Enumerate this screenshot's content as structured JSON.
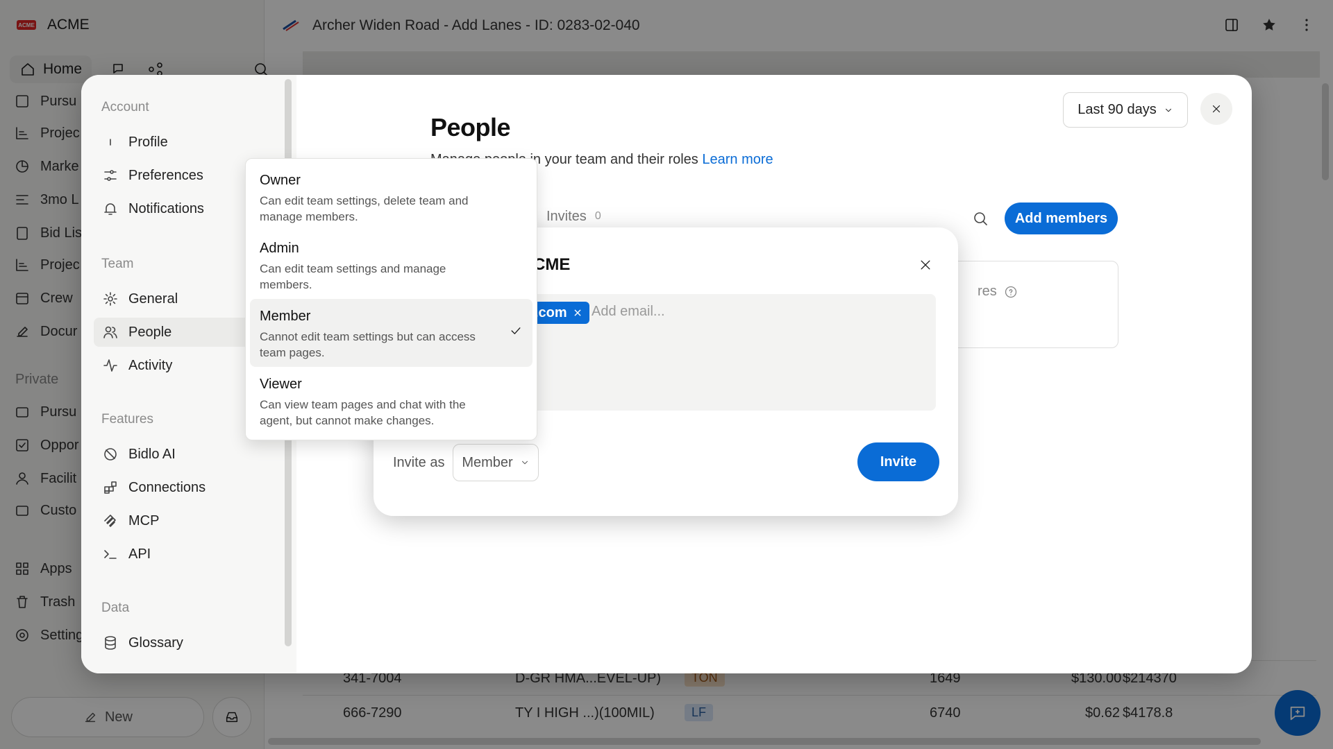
{
  "app": {
    "brand": "ACME",
    "brand_logo": "ACME",
    "home": "Home",
    "nav_items": [
      "Pursu",
      "Projec",
      "Marke",
      "3mo L",
      "Bid Lis",
      "Projec",
      "Crew",
      "Docur"
    ],
    "private_label": "Private",
    "private_items": [
      "Pursu",
      "Oppor",
      "Facilit",
      "Custo"
    ],
    "bottom_items": [
      "Apps",
      "Trash",
      "Setting"
    ],
    "new_label": "New"
  },
  "header": {
    "title": "Archer Widen Road - Add Lanes - ID: 0283-02-040"
  },
  "table": {
    "rows": [
      {
        "id": "341-7004",
        "desc": "D-GR HMA...EVEL-UP)",
        "unit": "TON",
        "qty": "1649",
        "price": "$130.00",
        "total": "$214370"
      },
      {
        "id": "666-7290",
        "desc": "TY I HIGH ...)(100MIL)",
        "unit": "LF",
        "qty": "6740",
        "price": "$0.62",
        "total": "$4178.8"
      }
    ]
  },
  "settings": {
    "groups": {
      "account": "Account",
      "team": "Team",
      "features": "Features",
      "data": "Data"
    },
    "items": {
      "profile": "Profile",
      "preferences": "Preferences",
      "notifications": "Notifications",
      "general": "General",
      "people": "People",
      "activity": "Activity",
      "bidlo_ai": "Bidlo AI",
      "connections": "Connections",
      "mcp": "MCP",
      "api": "API",
      "glossary": "Glossary"
    }
  },
  "people": {
    "title": "People",
    "subtitle": "Manage people in your team and their roles",
    "learn_more": "Learn more",
    "range": "Last 90 days",
    "tab_invites": "Invites",
    "invites_count": "0",
    "add_members": "Add members",
    "card_fragment": "res"
  },
  "invite": {
    "title_fragment": "CME",
    "email_chip": ".com",
    "email_placeholder": "Add email...",
    "invite_as_label": "Invite as",
    "selected_role": "Member",
    "invite_button": "Invite"
  },
  "roles": [
    {
      "name": "Owner",
      "desc": "Can edit team settings, delete team and manage members.",
      "selected": false
    },
    {
      "name": "Admin",
      "desc": "Can edit team settings and manage members.",
      "selected": false
    },
    {
      "name": "Member",
      "desc": "Cannot edit team settings but can access team pages.",
      "selected": true
    },
    {
      "name": "Viewer",
      "desc": "Can view team pages and chat with the agent, but cannot make changes.",
      "selected": false
    }
  ],
  "colors": {
    "accent": "#0a6cd6",
    "overlay": "rgba(0,0,0,0.46)"
  }
}
